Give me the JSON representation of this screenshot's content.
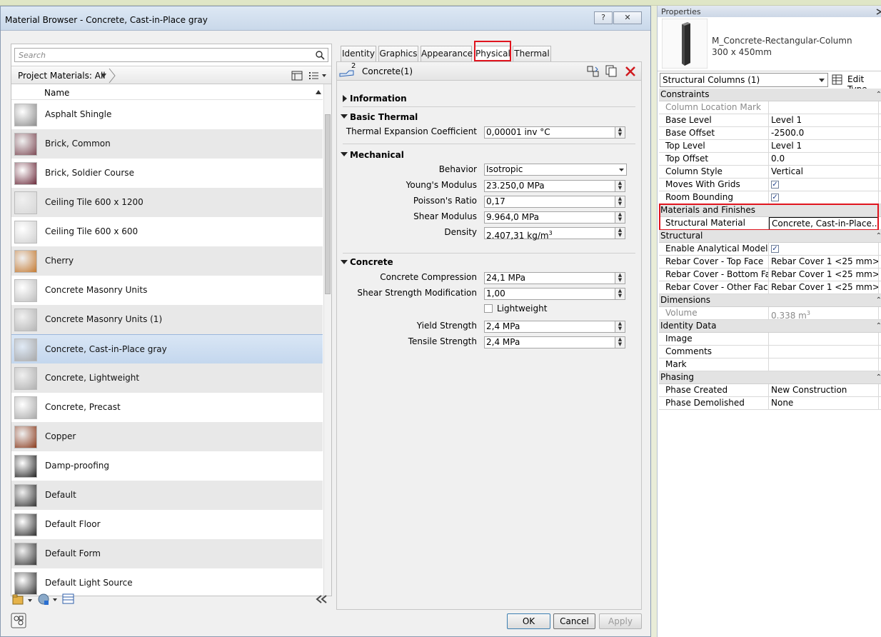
{
  "dialog": {
    "title": "Material Browser - Concrete, Cast-in-Place gray",
    "help_btn": "?",
    "close_btn": "✕",
    "search_placeholder": "Search",
    "filter_label": "Project Materials: All",
    "column_name": "Name",
    "materials": [
      {
        "name": "Asphalt Shingle",
        "color": "#8c8c8c"
      },
      {
        "name": "Brick, Common",
        "color": "#7d4a55"
      },
      {
        "name": "Brick, Soldier Course",
        "color": "#6a2a3a"
      },
      {
        "name": "Ceiling Tile 600 x 1200",
        "color": "#d6d6d6"
      },
      {
        "name": "Ceiling Tile 600 x 600",
        "color": "#cfcfcf"
      },
      {
        "name": "Cherry",
        "color": "#c47a32"
      },
      {
        "name": "Concrete Masonry Units",
        "color": "#bdbdbd"
      },
      {
        "name": "Concrete Masonry Units (1)",
        "color": "#b5b5b5"
      },
      {
        "name": "Concrete, Cast-in-Place gray",
        "color": "#a9a9a9",
        "selected": true
      },
      {
        "name": "Concrete, Lightweight",
        "color": "#b0b0b0"
      },
      {
        "name": "Concrete, Precast",
        "color": "#a8a8a8"
      },
      {
        "name": "Copper",
        "color": "#8a3a1c"
      },
      {
        "name": "Damp-proofing",
        "color": "#222222"
      },
      {
        "name": "Default",
        "color": "#333333"
      },
      {
        "name": "Default Floor",
        "color": "#2e2e2e"
      },
      {
        "name": "Default Form",
        "color": "#3a3a3a"
      },
      {
        "name": "Default Light Source",
        "color": "#333333"
      }
    ],
    "tabs": [
      "Identity",
      "Graphics",
      "Appearance",
      "Physical",
      "Thermal"
    ],
    "active_tab": "Physical",
    "asset_count": "2",
    "asset_name": "Concrete(1)",
    "sections": {
      "information": "Information",
      "basic_thermal": "Basic Thermal",
      "mechanical": "Mechanical",
      "concrete": "Concrete"
    },
    "thermal_expansion_label": "Thermal Expansion Coefficient",
    "thermal_expansion_value": "0,00001 inv °C",
    "behavior_label": "Behavior",
    "behavior_value": "Isotropic",
    "youngs_label": "Young's Modulus",
    "youngs_value": "23.250,0 MPa",
    "poisson_label": "Poisson's Ratio",
    "poisson_value": "0,17",
    "shear_label": "Shear Modulus",
    "shear_value": "9.964,0 MPa",
    "density_label": "Density",
    "density_value": "2.407,31 kg/m",
    "density_sup": "3",
    "compression_label": "Concrete Compression",
    "compression_value": "24,1 MPa",
    "shear_mod_label": "Shear Strength Modification",
    "shear_mod_value": "1,00",
    "lightweight_label": "Lightweight",
    "yield_label": "Yield Strength",
    "yield_value": "2,4 MPa",
    "tensile_label": "Tensile Strength",
    "tensile_value": "2,4 MPa",
    "ok": "OK",
    "cancel": "Cancel",
    "apply": "Apply"
  },
  "properties": {
    "title": "Properties",
    "type_name": "M_Concrete-Rectangular-Column",
    "type_size": "300 x 450mm",
    "selector": "Structural Columns (1)",
    "edit_type": "Edit Type",
    "groups": {
      "constraints": "Constraints",
      "materials": "Materials and Finishes",
      "structural": "Structural",
      "dimensions": "Dimensions",
      "identity": "Identity Data",
      "phasing": "Phasing"
    },
    "rows": {
      "column_location_mark": "Column Location Mark",
      "base_level": "Base Level",
      "base_level_v": "Level 1",
      "base_offset": "Base Offset",
      "base_offset_v": "-2500.0",
      "top_level": "Top Level",
      "top_level_v": "Level 1",
      "top_offset": "Top Offset",
      "top_offset_v": "0.0",
      "column_style": "Column Style",
      "column_style_v": "Vertical",
      "moves_with_grids": "Moves With Grids",
      "room_bounding": "Room Bounding",
      "structural_material": "Structural Material",
      "structural_material_v": "Concrete, Cast-in-Place...",
      "enable_analytical": "Enable Analytical Model",
      "rebar_top": "Rebar Cover - Top Face",
      "rebar_top_v": "Rebar Cover 1 <25 mm>",
      "rebar_bottom": "Rebar Cover - Bottom Face",
      "rebar_bottom_v": "Rebar Cover 1 <25 mm>",
      "rebar_other": "Rebar Cover - Other Faces",
      "rebar_other_v": "Rebar Cover 1 <25 mm>",
      "volume": "Volume",
      "volume_v": "0.338 m",
      "volume_sup": "3",
      "image": "Image",
      "comments": "Comments",
      "mark": "Mark",
      "phase_created": "Phase Created",
      "phase_created_v": "New Construction",
      "phase_demolished": "Phase Demolished",
      "phase_demolished_v": "None"
    }
  }
}
